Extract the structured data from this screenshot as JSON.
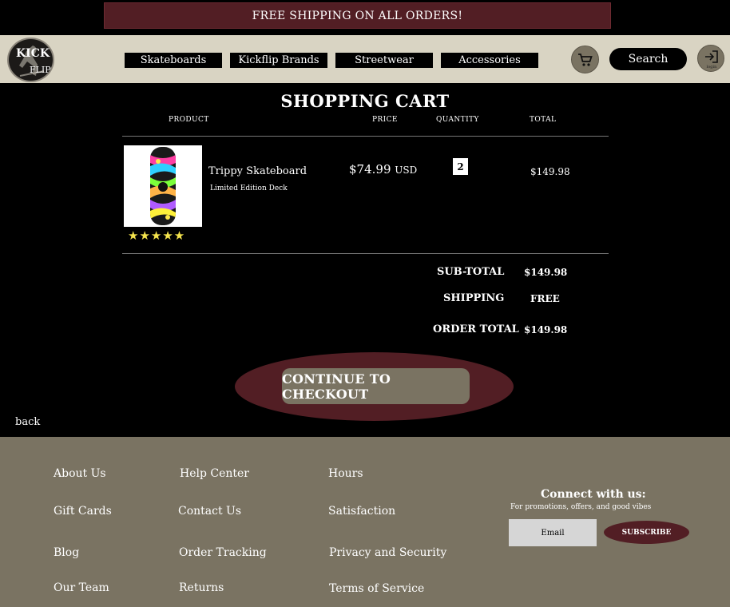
{
  "promo": {
    "text": "FREE SHIPPING ON ALL ORDERS!"
  },
  "logo": {
    "line1": "KICK",
    "line2": "FLIP"
  },
  "nav": {
    "items": [
      "Skateboards",
      "Kickflip Brands",
      "Streetwear",
      "Accessories"
    ],
    "search_label": "Search",
    "login_label": "login"
  },
  "cart": {
    "title": "SHOPPING CART",
    "columns": [
      "PRODUCT",
      "PRICE",
      "QUANTITY",
      "TOTAL"
    ],
    "item": {
      "name": "Trippy Skateboard",
      "subtitle": "Limited Edition Deck",
      "rating_stars": "★★★★★",
      "rating": 5,
      "price": "$74.99",
      "currency": "USD",
      "quantity": "2",
      "total": "$149.98"
    },
    "summary": {
      "subtotal_label": "SUB-TOTAL",
      "subtotal": "$149.98",
      "shipping_label": "SHIPPING",
      "shipping": "FREE",
      "order_total_label": "ORDER TOTAL",
      "order_total": "$149.98"
    },
    "checkout_label": "CONTINUE TO CHECKOUT",
    "back_label": "back"
  },
  "footer": {
    "col1": [
      "About Us",
      "Gift Cards",
      "Blog",
      "Our Team"
    ],
    "col2": [
      "Help Center",
      "Contact Us",
      "Order Tracking",
      "Returns"
    ],
    "col3": [
      "Hours",
      "Satisfaction",
      "Privacy and Security",
      "Terms of Service"
    ],
    "connect_title": "Connect with us:",
    "connect_sub": "For promotions, offers, and good vibes",
    "email_placeholder": "Email",
    "subscribe_label": "SUBSCRIBE"
  },
  "colors": {
    "accent_maroon": "#521e24",
    "taupe": "#7a7362",
    "nav_bg": "#d9d4c3",
    "star": "#f5e44d"
  },
  "icons": [
    "cart-icon",
    "login-icon",
    "skater-logo-icon"
  ]
}
